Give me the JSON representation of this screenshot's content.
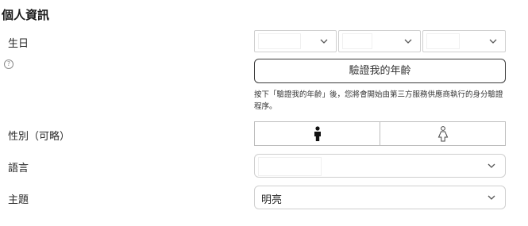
{
  "section": {
    "title": "個人資訊"
  },
  "birthday": {
    "label": "生日",
    "help_icon": "help-circle-icon",
    "verify_button": "驗證我的年齡",
    "note": "按下「驗證我的年齡」後，您將會開始由第三方服務供應商執行的身分驗證程序。"
  },
  "gender": {
    "label": "性別（可略）",
    "options": [
      {
        "icon": "male-icon",
        "selected": true
      },
      {
        "icon": "female-icon",
        "selected": false
      }
    ]
  },
  "language": {
    "label": "語言",
    "value": ""
  },
  "theme": {
    "label": "主題",
    "value": "明亮"
  }
}
